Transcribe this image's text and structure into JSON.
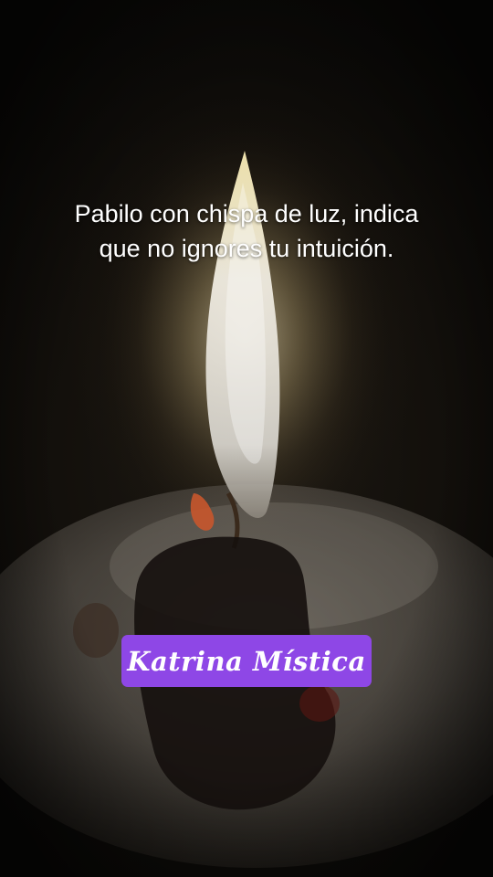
{
  "caption": {
    "line1": "Pabilo con chispa de luz,  indica",
    "line2": "que no ignores tu intuición."
  },
  "tag": {
    "label": "Katrina Mística",
    "color": "#8e47e6"
  }
}
